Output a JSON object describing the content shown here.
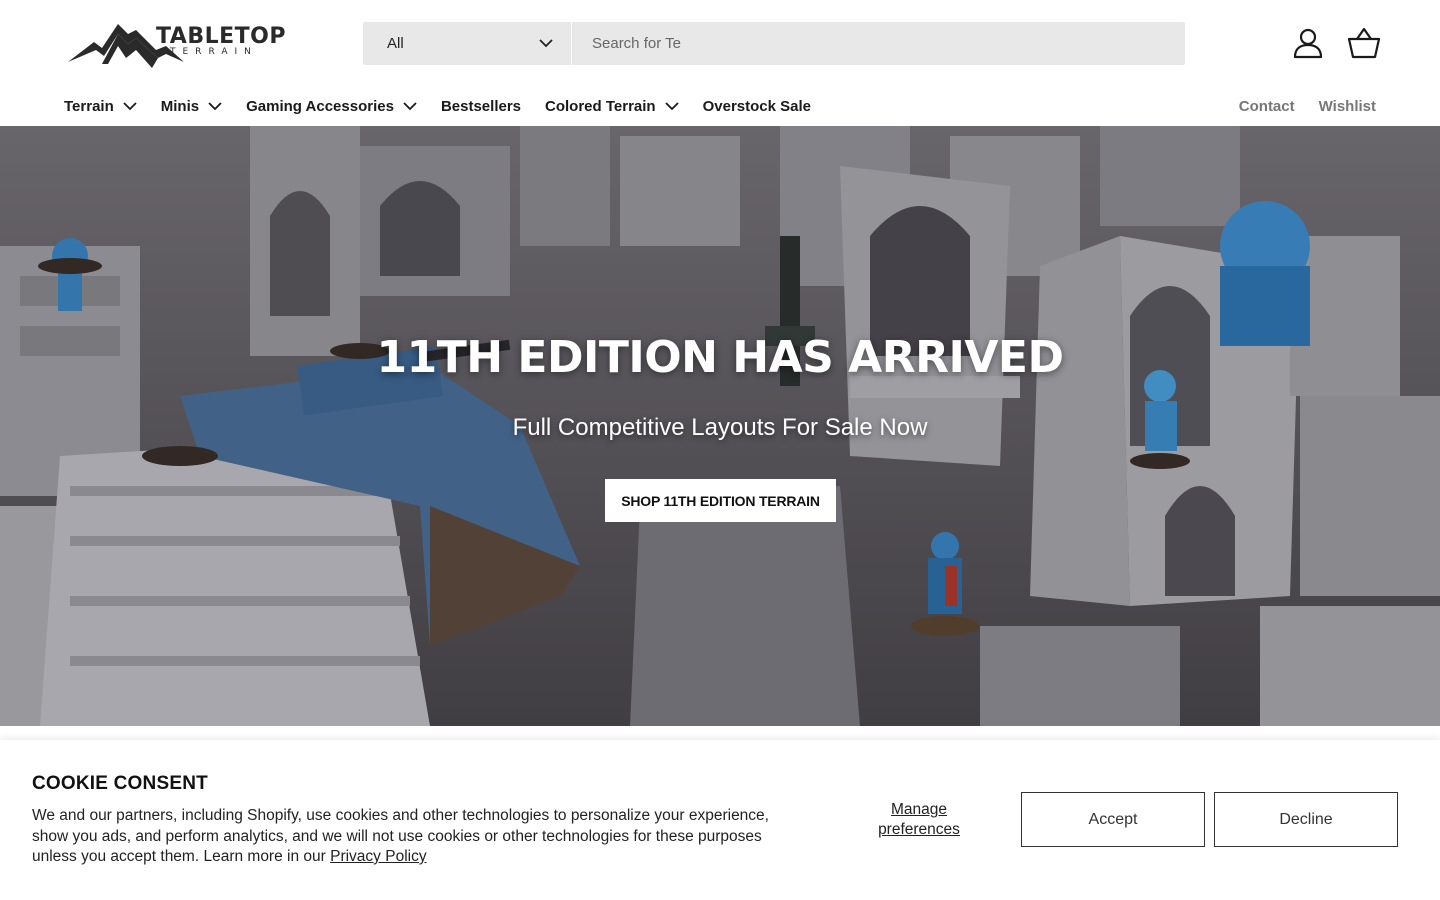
{
  "header": {
    "logo": {
      "word": "TABLETOP",
      "sub": "TERRAIN"
    },
    "search": {
      "category": "All",
      "placeholder": "Search for Te"
    },
    "icons": {
      "account": "user-icon",
      "cart": "basket-icon"
    }
  },
  "nav": {
    "items": [
      {
        "label": "Terrain",
        "dropdown": true
      },
      {
        "label": "Minis",
        "dropdown": true
      },
      {
        "label": "Gaming Accessories",
        "dropdown": true
      },
      {
        "label": "Bestsellers",
        "dropdown": false
      },
      {
        "label": "Colored Terrain",
        "dropdown": true
      },
      {
        "label": "Overstock Sale",
        "dropdown": false
      }
    ],
    "right": {
      "contact": "Contact",
      "wishlist": "Wishlist"
    }
  },
  "hero": {
    "title": "11TH EDITION HAS ARRIVED",
    "subtitle": "Full Competitive Layouts For Sale Now",
    "button": "SHOP 11TH EDITION TERRAIN"
  },
  "cookie": {
    "title": "COOKIE CONSENT",
    "text": "We and our partners, including Shopify, use cookies and other technologies to personalize your experience, show you ads, and perform analytics, and we will not use cookies or other technologies for these purposes unless you accept them. Learn more in our ",
    "link": "Privacy Policy",
    "manage": "Manage preferences",
    "accept": "Accept",
    "decline": "Decline"
  }
}
